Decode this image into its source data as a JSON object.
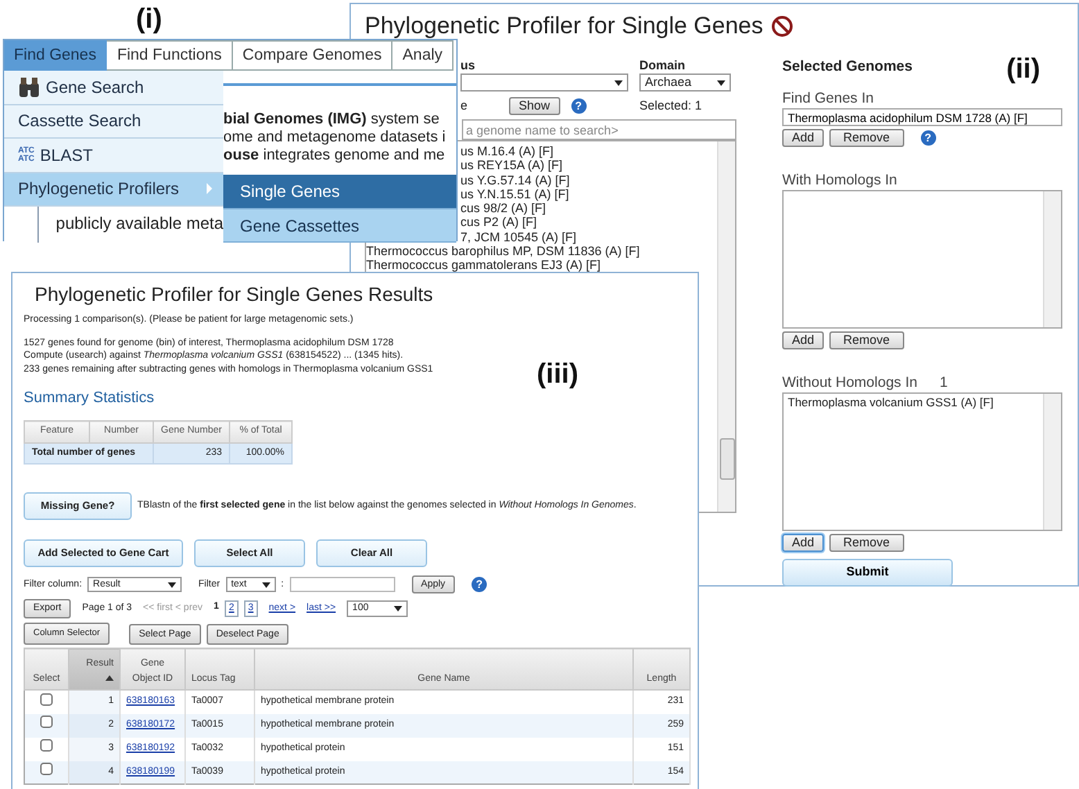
{
  "menu_window": {
    "label": "(i)",
    "tabs": [
      {
        "label": "Find Genes",
        "selected": true
      },
      {
        "label": "Find Functions",
        "selected": false
      },
      {
        "label": "Compare Genomes",
        "selected": false
      },
      {
        "label": "Analy",
        "selected": false
      }
    ],
    "menu_items": [
      {
        "label": "Gene Search",
        "kind": "search",
        "selected": false
      },
      {
        "label": "Cassette Search",
        "kind": "plain",
        "selected": false
      },
      {
        "label": "BLAST",
        "kind": "blast",
        "icon_lines": [
          "ATC",
          "ATC"
        ],
        "selected": false
      },
      {
        "label": "Phylogenetic Profilers",
        "kind": "submenu",
        "selected": true
      }
    ],
    "submenu_items": [
      {
        "label": "Single Genes",
        "selected": true
      },
      {
        "label": "Gene Cassettes",
        "selected": false
      }
    ],
    "page_text": [
      "**bial Genomes (IMG)** system se",
      "ome and metagenome datasets i",
      "**ouse** integrates genome and me"
    ],
    "page_text_below": "publicly available meta"
  },
  "profiler_window": {
    "label": "(ii)",
    "title": "Phylogenetic Profiler for Single Genes",
    "genus_label": "us",
    "domain_label": "Domain",
    "domain_value": "Archaea",
    "genome_label": "e",
    "show_button": "Show",
    "help": "?",
    "selected_count": "Selected: 1",
    "search_placeholder": "a genome name to search>",
    "genomes": [
      "us M.16.4 (A) [F]",
      "us REY15A (A) [F]",
      "us Y.G.57.14 (A) [F]",
      "us Y.N.15.51 (A) [F]",
      "cus 98/2 (A) [F]",
      "cus P2 (A) [F]",
      "7, JCM 10545 (A) [F]",
      "Thermococcus barophilus MP, DSM 11836 (A) [F]",
      "Thermococcus gammatolerans EJ3 (A) [F]"
    ],
    "selected_heading": "Selected Genomes",
    "groups": [
      {
        "label": "Find Genes In",
        "kind": "field",
        "value": "Thermoplasma acidophilum DSM 1728 (A) [F]",
        "help": "?",
        "buttons": [
          {
            "label": "Add",
            "focused": false
          },
          {
            "label": "Remove",
            "focused": false
          }
        ]
      },
      {
        "label": "With Homologs In",
        "kind": "list",
        "buttons": [
          {
            "label": "Add",
            "focused": false
          },
          {
            "label": "Remove",
            "focused": false
          }
        ]
      },
      {
        "label": "Without Homologs In",
        "count": "1",
        "kind": "list",
        "items": [
          "Thermoplasma volcanium GSS1 (A) [F]"
        ],
        "buttons": [
          {
            "label": "Add",
            "focused": true
          },
          {
            "label": "Remove",
            "focused": false
          }
        ]
      }
    ],
    "submit_button": "Submit"
  },
  "results_window": {
    "label": "(iii)",
    "title": "Phylogenetic Profiler for Single Genes Results",
    "processing_note": "Processing 1 comparison(s). (Please be patient for large metagenomic sets.)",
    "log_lines": [
      "1527 genes found for genome (bin) of interest, Thermoplasma acidophilum DSM 1728",
      "Compute (usearch) against *Thermoplasma volcanium GSS1* (638154522) ... (1345 hits).",
      "233 genes remaining after subtracting genes with homologs in Thermoplasma volcanium GSS1"
    ],
    "summary_heading": "Summary Statistics",
    "summary_table": {
      "columns": [
        "Feature",
        "Number",
        "Gene Number",
        "% of Total"
      ],
      "rows": [
        {
          "label": "Total number of genes",
          "gene_number": "233",
          "percent": "100.00%"
        }
      ]
    },
    "missing_gene_button": "Missing Gene?",
    "missing_gene_note": "TBlastn of the **first selected gene** in the list below against the genomes selected in *Without Homologs In Genomes*.",
    "action_buttons": [
      "Add Selected to Gene Cart",
      "Select All",
      "Clear All"
    ],
    "filter": {
      "column_label": "Filter column:",
      "column_value": "Result",
      "filter_label": "Filter",
      "filter_value": "text",
      "separator": ":",
      "apply_button": "Apply",
      "help": "?"
    },
    "paging": {
      "export_button": "Export",
      "page_label": "Page 1 of 3",
      "first_prev": "<< first < prev",
      "pages": [
        {
          "label": "1",
          "selected": true
        },
        {
          "label": "2",
          "selected": false
        },
        {
          "label": "3",
          "selected": false
        }
      ],
      "next": "next >",
      "last": "last >>",
      "page_size": "100"
    },
    "column_selector_button": "Column Selector",
    "select_page_button": "Select Page",
    "deselect_page_button": "Deselect Page",
    "table": {
      "columns": [
        {
          "label": "Select",
          "sorted": false
        },
        {
          "label": "Result",
          "sorted": true
        },
        {
          "label": "Gene Object ID",
          "sorted": false
        },
        {
          "label": "Locus Tag",
          "sorted": false
        },
        {
          "label": "Gene Name",
          "sorted": false
        },
        {
          "label": "Length",
          "sorted": false
        }
      ],
      "rows": [
        {
          "checked": false,
          "result": "1",
          "gene_id": "638180163",
          "locus_tag": "Ta0007",
          "gene_name": "hypothetical membrane protein",
          "length": "231"
        },
        {
          "checked": false,
          "result": "2",
          "gene_id": "638180172",
          "locus_tag": "Ta0015",
          "gene_name": "hypothetical membrane protein",
          "length": "259"
        },
        {
          "checked": false,
          "result": "3",
          "gene_id": "638180192",
          "locus_tag": "Ta0032",
          "gene_name": "hypothetical protein",
          "length": "151"
        },
        {
          "checked": false,
          "result": "4",
          "gene_id": "638180199",
          "locus_tag": "Ta0039",
          "gene_name": "hypothetical protein",
          "length": "154"
        }
      ]
    }
  }
}
